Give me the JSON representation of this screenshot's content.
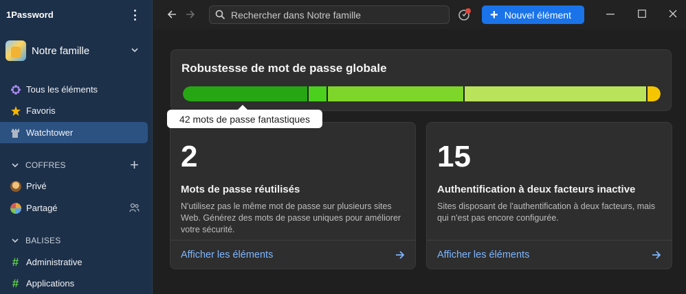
{
  "app": {
    "title": "1Password"
  },
  "account": {
    "name": "Notre famille"
  },
  "sidebar": {
    "nav": [
      {
        "label": "Tous les éléments"
      },
      {
        "label": "Favoris"
      },
      {
        "label": "Watchtower"
      }
    ],
    "vaults_header": "COFFRES",
    "vaults": [
      {
        "label": "Privé"
      },
      {
        "label": "Partagé"
      }
    ],
    "tags_header": "BALISES",
    "tags": [
      {
        "label": "Administrative"
      },
      {
        "label": "Applications"
      }
    ]
  },
  "topbar": {
    "search_placeholder": "Rechercher dans Notre famille",
    "new_item_label": "Nouvel élément"
  },
  "watchtower": {
    "strength_title": "Robustesse de mot de passe globale",
    "tooltip": "42 mots de passe fantastiques",
    "cards": [
      {
        "number": "2",
        "title": "Mots de passe réutilisés",
        "description": "N'utilisez pas le même mot de passe sur plusieurs sites Web. Générez des mots de passe uniques pour améliorer votre sécurité.",
        "link": "Afficher les éléments"
      },
      {
        "number": "15",
        "title": "Authentification à deux facteurs inactive",
        "description": "Sites disposant de l'authentification à deux facteurs, mais qui n'est pas encore configurée.",
        "link": "Afficher les éléments"
      }
    ]
  },
  "colors": {
    "accent": "#1a73e8",
    "sidebar_bg": "#1d3049",
    "sidebar_active": "#2c5282",
    "strength_segments": [
      "#27a614",
      "#4bd01e",
      "#7fd62a",
      "#b9e35a",
      "#f5c500"
    ]
  }
}
